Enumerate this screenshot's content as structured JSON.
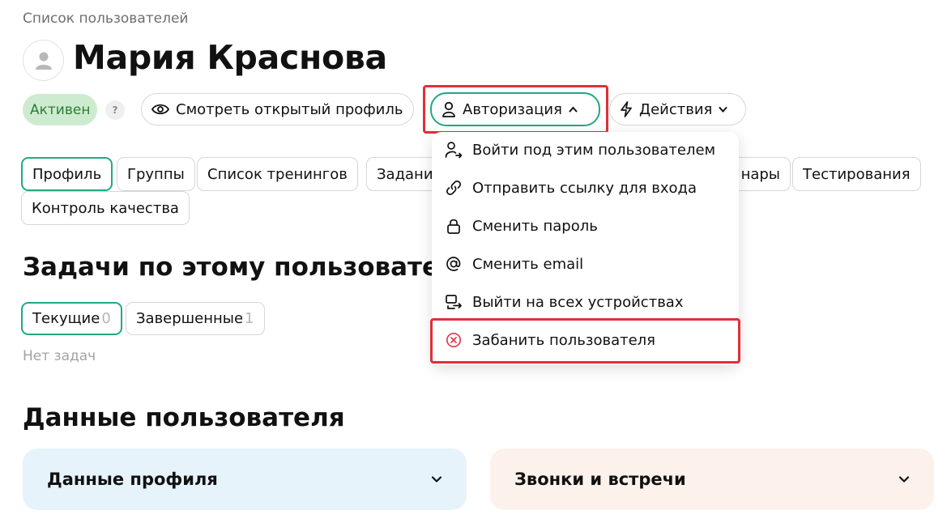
{
  "breadcrumb": "Список пользователей",
  "user": {
    "name": "Мария Краснова",
    "status": "Активен",
    "help": "?"
  },
  "actions": {
    "view_profile": "Смотреть открытый профиль",
    "auth": "Авторизация",
    "actions": "Действия"
  },
  "tabs": [
    "Профиль",
    "Группы",
    "Список тренингов",
    "Задани",
    "нары",
    "Тестирования",
    "Контроль качества"
  ],
  "tasks": {
    "title": "Задачи по этому пользовател",
    "filters": [
      {
        "label": "Текущие",
        "count": "0"
      },
      {
        "label": "Завершенные",
        "count": "1"
      }
    ],
    "empty": "Нет задач"
  },
  "user_data": {
    "title": "Данные пользователя",
    "cards": [
      "Данные профиля",
      "Звонки и встречи"
    ]
  },
  "auth_menu": {
    "items": [
      {
        "label": "Войти под этим пользователем",
        "icon": "user-login-icon"
      },
      {
        "label": "Отправить ссылку для входа",
        "icon": "link-icon"
      },
      {
        "label": "Сменить пароль",
        "icon": "lock-icon"
      },
      {
        "label": "Сменить email",
        "icon": "at-icon"
      },
      {
        "label": "Выйти на всех устройствах",
        "icon": "logout-devices-icon"
      },
      {
        "label": "Забанить пользователя",
        "icon": "ban-icon"
      }
    ]
  },
  "colors": {
    "accent": "#22a884",
    "status_bg": "#cdeccf",
    "status_text": "#2c7c39",
    "highlight": "#e0303a",
    "danger": "#e03a4e",
    "card_blue": "#e7f3fb",
    "card_peach": "#fdf1eb"
  }
}
